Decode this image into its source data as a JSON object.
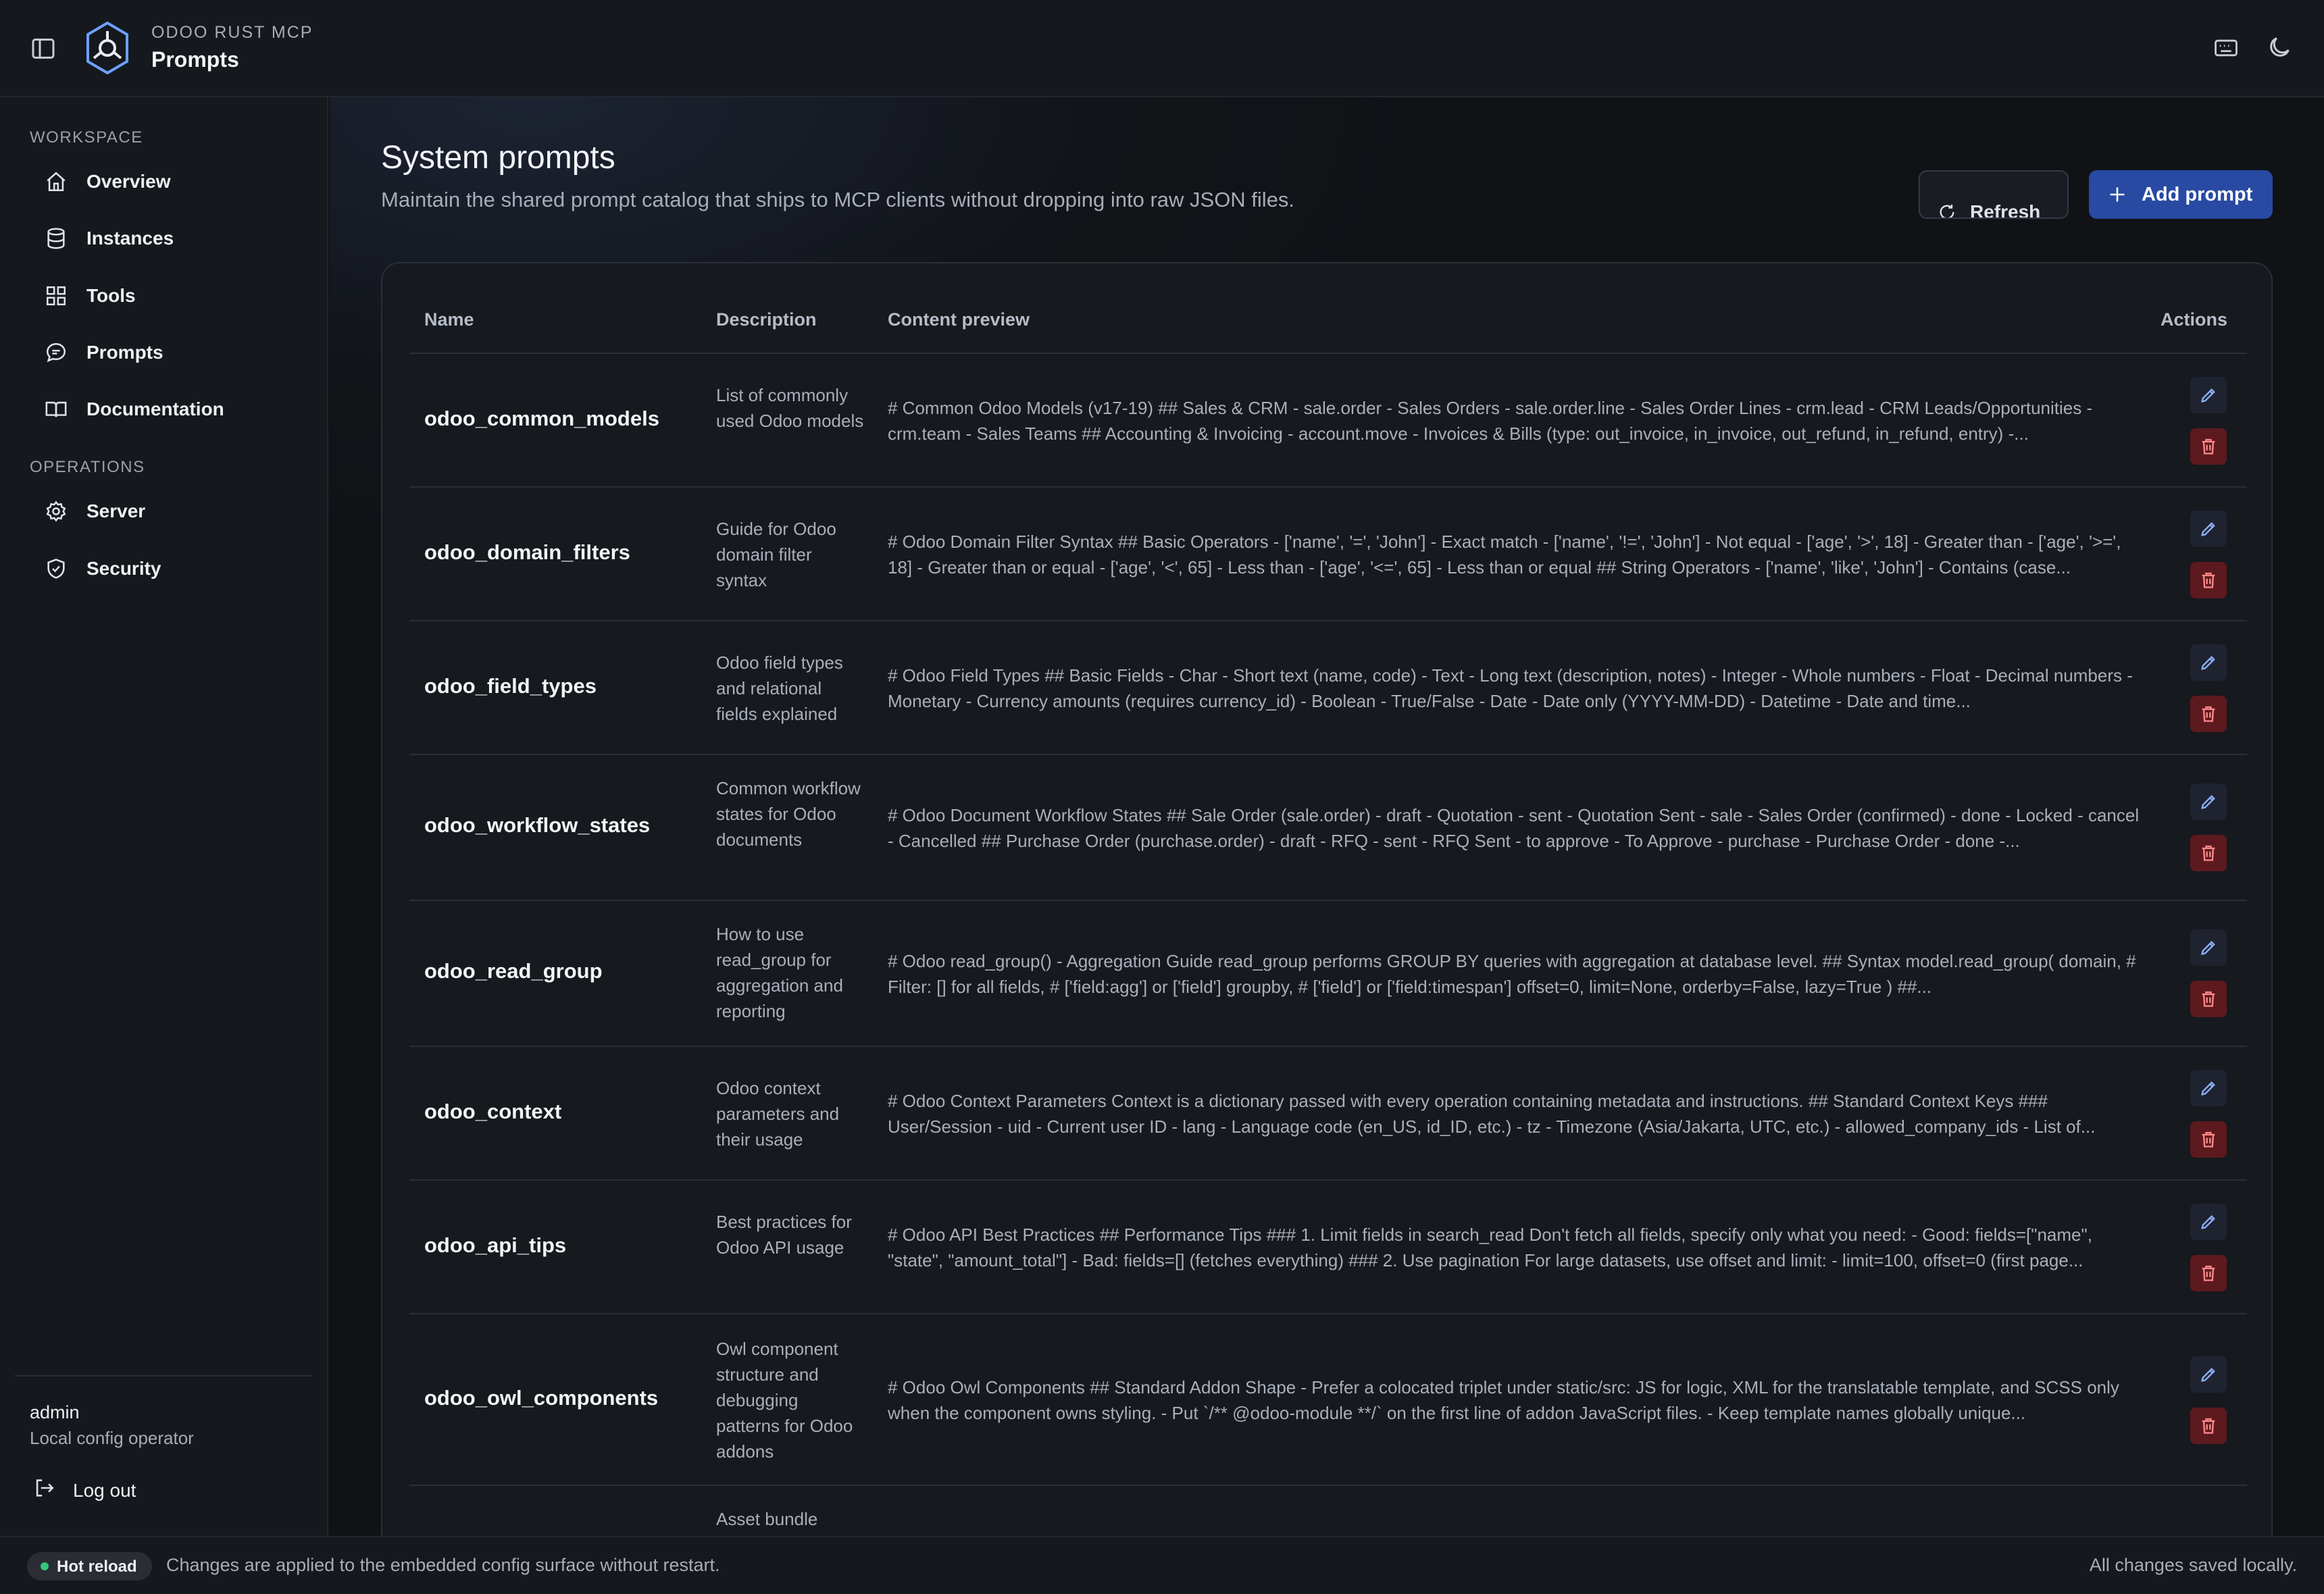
{
  "header": {
    "kicker": "ODOO RUST MCP",
    "title": "Prompts"
  },
  "sidebar": {
    "workspace_label": "WORKSPACE",
    "operations_label": "OPERATIONS",
    "workspace_items": [
      {
        "label": "Overview",
        "icon": "home-icon"
      },
      {
        "label": "Instances",
        "icon": "database-icon"
      },
      {
        "label": "Tools",
        "icon": "grid-icon"
      },
      {
        "label": "Prompts",
        "icon": "chat-icon"
      },
      {
        "label": "Documentation",
        "icon": "book-icon"
      }
    ],
    "operations_items": [
      {
        "label": "Server",
        "icon": "gear-icon"
      },
      {
        "label": "Security",
        "icon": "shield-icon"
      }
    ],
    "user": {
      "name": "admin",
      "role": "Local config operator"
    },
    "logout_label": "Log out"
  },
  "page": {
    "title": "System prompts",
    "subtitle": "Maintain the shared prompt catalog that ships to MCP clients without dropping into raw JSON files.",
    "refresh_label": "Refresh",
    "add_label": "Add prompt"
  },
  "table": {
    "columns": [
      "Name",
      "Description",
      "Content preview",
      "Actions"
    ],
    "rows": [
      {
        "name": "odoo_common_models",
        "description": "List of commonly used Odoo models",
        "preview": "# Common Odoo Models (v17-19) ## Sales & CRM - sale.order - Sales Orders - sale.order.line - Sales Order Lines - crm.lead - CRM Leads/Opportunities - crm.team - Sales Teams ## Accounting & Invoicing - account.move - Invoices & Bills (type: out_invoice, in_invoice, out_refund, in_refund, entry) -..."
      },
      {
        "name": "odoo_domain_filters",
        "description": "Guide for Odoo domain filter syntax",
        "preview": "# Odoo Domain Filter Syntax ## Basic Operators - ['name', '=', 'John'] - Exact match - ['name', '!=', 'John'] - Not equal - ['age', '>', 18] - Greater than - ['age', '>=', 18] - Greater than or equal - ['age', '<', 65] - Less than - ['age', '<=', 65] - Less than or equal ## String Operators - ['name', 'like', 'John'] - Contains (case..."
      },
      {
        "name": "odoo_field_types",
        "description": "Odoo field types and relational fields explained",
        "preview": "# Odoo Field Types ## Basic Fields - Char - Short text (name, code) - Text - Long text (description, notes) - Integer - Whole numbers - Float - Decimal numbers - Monetary - Currency amounts (requires currency_id) - Boolean - True/False - Date - Date only (YYYY-MM-DD) - Datetime - Date and time..."
      },
      {
        "name": "odoo_workflow_states",
        "description": "Common workflow states for Odoo documents",
        "preview": "# Odoo Document Workflow States ## Sale Order (sale.order) - draft - Quotation - sent - Quotation Sent - sale - Sales Order (confirmed) - done - Locked - cancel - Cancelled ## Purchase Order (purchase.order) - draft - RFQ - sent - RFQ Sent - to approve - To Approve - purchase - Purchase Order - done -..."
      },
      {
        "name": "odoo_read_group",
        "description": "How to use read_group for aggregation and reporting",
        "preview": "# Odoo read_group() - Aggregation Guide read_group performs GROUP BY queries with aggregation at database level. ## Syntax model.read_group( domain, # Filter: [] for all fields, # ['field:agg'] or ['field'] groupby, # ['field'] or ['field:timespan'] offset=0, limit=None, orderby=False, lazy=True ) ##..."
      },
      {
        "name": "odoo_context",
        "description": "Odoo context parameters and their usage",
        "preview": "# Odoo Context Parameters Context is a dictionary passed with every operation containing metadata and instructions. ## Standard Context Keys ### User/Session - uid - Current user ID - lang - Language code (en_US, id_ID, etc.) - tz - Timezone (Asia/Jakarta, UTC, etc.) - allowed_company_ids - List of..."
      },
      {
        "name": "odoo_api_tips",
        "description": "Best practices for Odoo API usage",
        "preview": "# Odoo API Best Practices ## Performance Tips ### 1. Limit fields in search_read Don't fetch all fields, specify only what you need: - Good: fields=[\"name\", \"state\", \"amount_total\"] - Bad: fields=[] (fetches everything) ### 2. Use pagination For large datasets, use offset and limit: - limit=100, offset=0 (first page..."
      },
      {
        "name": "odoo_owl_components",
        "description": "Owl component structure and debugging patterns for Odoo addons",
        "preview": "# Odoo Owl Components ## Standard Addon Shape - Prefer a colocated triplet under static/src: JS for logic, XML for the translatable template, and SCSS only when the component owns styling. - Put `/** @odoo-module **/` on the first line of addon JavaScript files. - Keep template names globally unique..."
      },
      {
        "name": "",
        "description": "Asset bundle",
        "preview": ""
      }
    ]
  },
  "footer": {
    "badge_label": "Hot reload",
    "message": "Changes are applied to the embedded config surface without restart.",
    "status": "All changes saved locally."
  }
}
